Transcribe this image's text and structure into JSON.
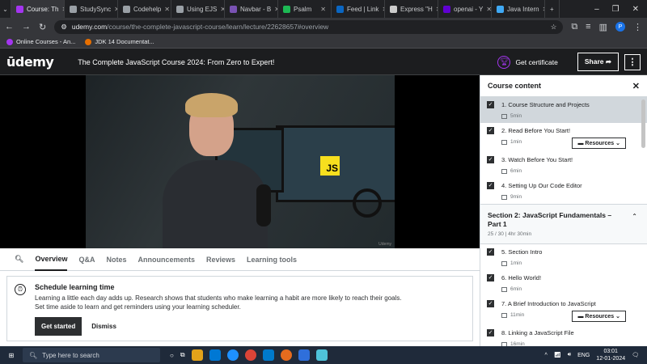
{
  "browser": {
    "tabs": [
      {
        "label": "Course: Th",
        "color": "#a435f0",
        "active": true
      },
      {
        "label": "StudySync",
        "color": "#9aa0a6"
      },
      {
        "label": "Codehelp",
        "color": "#9aa0a6"
      },
      {
        "label": "Using EJS",
        "color": "#9aa0a6"
      },
      {
        "label": "Navbar - B",
        "color": "#7952b3"
      },
      {
        "label": "Psalm",
        "color": "#1db954"
      },
      {
        "label": "Feed | Link",
        "color": "#0a66c2"
      },
      {
        "label": "Express \"H",
        "color": "#cccccc"
      },
      {
        "label": "openai - Y",
        "color": "#6001d2"
      },
      {
        "label": "Java Intern",
        "color": "#3fa9f5"
      }
    ],
    "url_host": "udemy.com",
    "url_path": "/course/the-complete-javascript-course/learn/lecture/22628657#overview",
    "profile": "P",
    "bookmarks": [
      {
        "label": "Online Courses - An...",
        "color": "#a435f0"
      },
      {
        "label": "JDK 14 Documentat...",
        "color": "#e76f00"
      }
    ]
  },
  "header": {
    "logo": "ūdemy",
    "course_title": "The Complete JavaScript Course 2024: From Zero to Expert!",
    "get_certificate": "Get certificate",
    "share": "Share"
  },
  "video": {
    "js_label": "JS"
  },
  "nav_tabs": [
    "Overview",
    "Q&A",
    "Notes",
    "Announcements",
    "Reviews",
    "Learning tools"
  ],
  "reminder": {
    "title": "Schedule learning time",
    "text1": "Learning a little each day adds up. Research shows that students who make learning a habit are more likely to reach their goals.",
    "text2": "Set time aside to learn and get reminders using your learning scheduler.",
    "get_started": "Get started",
    "dismiss": "Dismiss"
  },
  "sidebar": {
    "title": "Course content",
    "items1": [
      {
        "title": "1. Course Structure and Projects",
        "dur": "5min",
        "current": true
      },
      {
        "title": "2. Read Before You Start!",
        "dur": "1min",
        "resources": "Resources"
      },
      {
        "title": "3. Watch Before You Start!",
        "dur": "6min"
      },
      {
        "title": "4. Setting Up Our Code Editor",
        "dur": "9min"
      }
    ],
    "section": {
      "title": "Section 2: JavaScript Fundamentals – Part 1",
      "sub": "25 / 30 | 4hr 30min"
    },
    "items2": [
      {
        "title": "5. Section Intro",
        "dur": "1min"
      },
      {
        "title": "6. Hello World!",
        "dur": "6min"
      },
      {
        "title": "7. A Brief Introduction to JavaScript",
        "dur": "11min",
        "resources": "Resources"
      },
      {
        "title": "8. Linking a JavaScript File",
        "dur": "16min"
      }
    ]
  },
  "taskbar": {
    "search": "Type here to search",
    "lang": "ENG",
    "time": "03:01",
    "date": "12-01-2024"
  }
}
